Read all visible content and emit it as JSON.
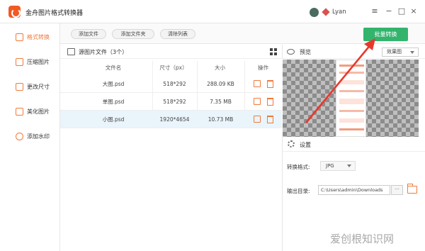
{
  "window": {
    "title": "金舟图片格式转换器",
    "user_name": "Lyan",
    "minimize": "−",
    "maximize": "□",
    "close": "×",
    "menu": "≡"
  },
  "sidebar": {
    "items": [
      {
        "label": "格式转换",
        "icon": "format-convert-icon",
        "active": true
      },
      {
        "label": "压缩图片",
        "icon": "compress-icon"
      },
      {
        "label": "更改尺寸",
        "icon": "resize-icon"
      },
      {
        "label": "美化图片",
        "icon": "beautify-icon"
      },
      {
        "label": "添加水印",
        "icon": "watermark-icon"
      }
    ]
  },
  "toolbar": {
    "add_file": "添加文件",
    "add_folder": "添加文件夹",
    "clear_list": "清除列表",
    "convert": "批量转换"
  },
  "file_list": {
    "title": "源图片文件（3个）",
    "columns": [
      "文件名",
      "尺寸（px）",
      "大小",
      "操作"
    ],
    "rows": [
      {
        "name": "大图.psd",
        "size_px": "518*292",
        "size": "288.09 KB"
      },
      {
        "name": "单图.psd",
        "size_px": "518*292",
        "size": "7.35 MB"
      },
      {
        "name": "小图.psd",
        "size_px": "1920*4654",
        "size": "10.73 MB"
      }
    ]
  },
  "preview": {
    "title": "预览",
    "mode": "效果图"
  },
  "settings": {
    "title": "设置",
    "format_label": "转换格式:",
    "format_value": "JPG",
    "output_label": "输出目录:",
    "output_value": "C:\\Users\\admin\\Downloads",
    "more": "···"
  },
  "watermark": "爱创根知识网",
  "colors": {
    "accent": "#f07a3a",
    "primary": "#32b46c",
    "arrow": "#e8382c"
  }
}
